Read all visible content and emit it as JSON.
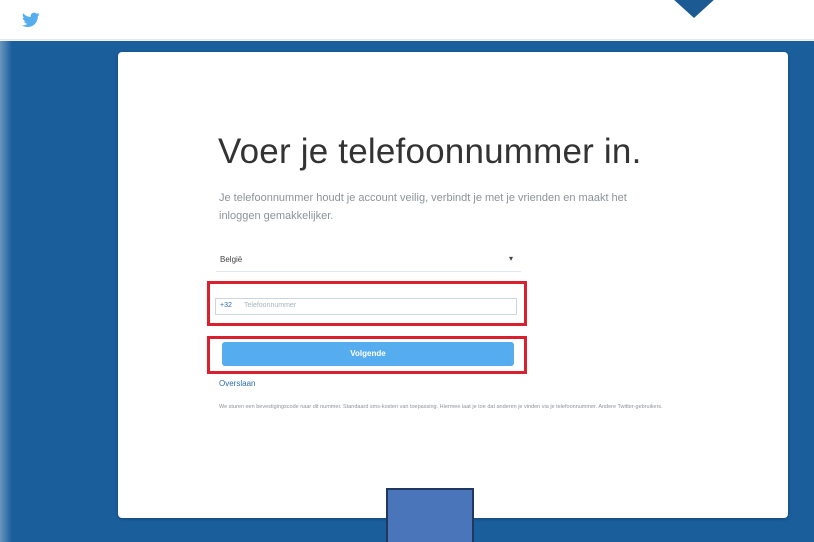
{
  "header": {
    "logo_icon": "twitter-bird-icon",
    "brand_color": "#1da1f2"
  },
  "page": {
    "background_color": "#1a5e9c",
    "title": "Voer je telefoonnummer in.",
    "description": "Je telefoonnummer houdt je account veilig, verbindt je met je vrienden en maakt het inloggen gemakkelijker.",
    "country_select": {
      "value": "België",
      "caret": "▾"
    },
    "phone_input": {
      "country_code": "+32",
      "placeholder": "Telefoonnummer"
    },
    "next_button_label": "Volgende",
    "next_button_color": "#55acee",
    "skip_link": "Overslaan",
    "fine_print": "We sturen een bevestigingscode naar dit nummer. Standaard sms-kosten van toepassing. Hiermee laat je toe dat anderen je vinden via je telefoonnummer. Andere Twitter-gebruikers."
  },
  "annotations": {
    "highlight_color": "#d8202f"
  }
}
